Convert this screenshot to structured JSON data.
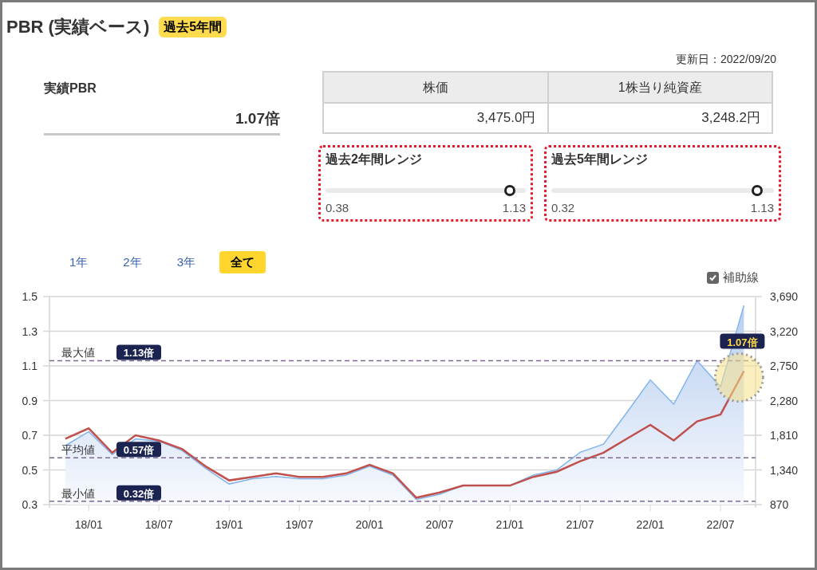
{
  "header": {
    "title": "PBR (実績ベース)",
    "badge": "過去5年間"
  },
  "updated": "更新日：2022/09/20",
  "summary": {
    "label": "実績PBR",
    "value": "1.07倍"
  },
  "price_table": {
    "columns": [
      "株価",
      "1株当り純資産"
    ],
    "values": [
      "3,475.0円",
      "3,248.2円"
    ]
  },
  "ranges": [
    {
      "title": "過去2年間レンジ",
      "min": "0.38",
      "max": "1.13",
      "level": 0.92
    },
    {
      "title": "過去5年間レンジ",
      "min": "0.32",
      "max": "1.13",
      "level": 0.926
    }
  ],
  "period_tabs": [
    {
      "label": "1年",
      "selected": false
    },
    {
      "label": "2年",
      "selected": false
    },
    {
      "label": "3年",
      "selected": false
    },
    {
      "label": "全て",
      "selected": true
    }
  ],
  "helper_lines": {
    "label": "補助線",
    "checked": true
  },
  "chart": {
    "chart_data": {
      "type": "area",
      "grid": true,
      "categories": [
        null,
        "18/01",
        null,
        null,
        "18/07",
        null,
        null,
        "19/01",
        null,
        null,
        "19/07",
        null,
        null,
        "20/01",
        null,
        null,
        "20/07",
        null,
        null,
        "21/01",
        null,
        null,
        "21/07",
        null,
        null,
        "22/01",
        null,
        null,
        "22/07",
        null
      ],
      "series": [
        {
          "color": "#80b4ec",
          "axis": "y2",
          "values": [
            1670,
            1860,
            1550,
            1760,
            1730,
            1600,
            1360,
            1150,
            1220,
            1250,
            1220,
            1220,
            1270,
            1390,
            1270,
            940,
            1010,
            1130,
            1130,
            1130,
            1270,
            1340,
            1580,
            1690,
            2120,
            2560,
            2230,
            2820,
            2470,
            3570
          ]
        },
        {
          "color": "#c0504d",
          "type": "line",
          "values": [
            0.68,
            0.74,
            0.6,
            0.7,
            0.67,
            0.62,
            0.52,
            0.44,
            0.46,
            0.48,
            0.46,
            0.46,
            0.48,
            0.53,
            0.48,
            0.34,
            0.37,
            0.41,
            0.41,
            0.41,
            0.46,
            0.49,
            0.55,
            0.6,
            0.68,
            0.76,
            0.67,
            0.78,
            0.82,
            1.07
          ]
        }
      ],
      "ylim": [
        0.3,
        1.5
      ],
      "yticks": [
        {
          "value": 0.3,
          "label": "0.3"
        },
        {
          "value": 0.5,
          "label": "0.5"
        },
        {
          "value": 0.7,
          "label": "0.7"
        },
        {
          "value": 0.9,
          "label": "0.9"
        },
        {
          "value": 1.1,
          "label": "1.1"
        },
        {
          "value": 1.3,
          "label": "1.3"
        },
        {
          "value": 1.5,
          "label": "1.5"
        }
      ],
      "y2lim": [
        870,
        3690
      ],
      "y2ticks": [
        {
          "value": 870,
          "label": "870"
        },
        {
          "value": 1340,
          "label": "1,340"
        },
        {
          "value": 1810,
          "label": "1,810"
        },
        {
          "value": 2280,
          "label": "2,280"
        },
        {
          "value": 2750,
          "label": "2,750"
        },
        {
          "value": 3220,
          "label": "3,220"
        },
        {
          "value": 3690,
          "label": "3,690"
        }
      ],
      "ref_lines": [
        {
          "axis": "y",
          "value": 1.13,
          "label": "1.13倍"
        },
        {
          "axis": "y",
          "value": 0.57,
          "label": "0.57倍"
        },
        {
          "axis": "y",
          "value": 0.32,
          "label": "0.32倍"
        }
      ],
      "annotations": [
        "最大値",
        "平均値",
        "最小値",
        "1.07倍"
      ]
    }
  }
}
